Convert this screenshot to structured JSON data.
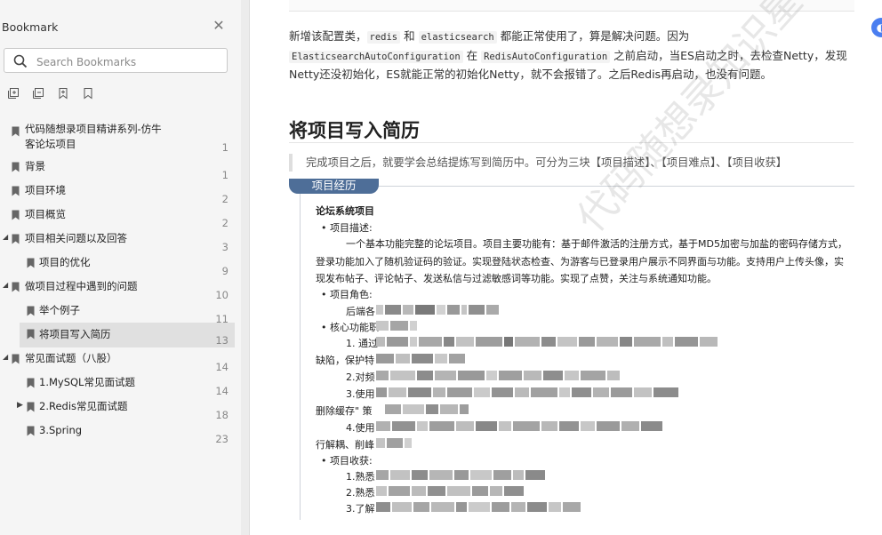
{
  "sidebar": {
    "title": "Bookmark",
    "search_placeholder": "Search Bookmarks",
    "bookmarks": [
      {
        "label": "代码随想录项目精讲系列-仿牛",
        "label2": "客论坛项目",
        "page": "1"
      },
      {
        "label": "背景",
        "page": "1"
      },
      {
        "label": "项目环境",
        "page": "2"
      },
      {
        "label": "项目概览",
        "page": "2"
      },
      {
        "label": "项目相关问题以及回答",
        "page": "3"
      },
      {
        "label": "项目的优化",
        "page": "9"
      },
      {
        "label": "做项目过程中遇到的问题",
        "page": "10"
      },
      {
        "label": "举个例子",
        "page": "11"
      },
      {
        "label": "将项目写入简历",
        "page": "13"
      },
      {
        "label": "常见面试题（八股）",
        "page": "14"
      },
      {
        "label": "1.MySQL常见面试题",
        "page": "14"
      },
      {
        "label": "2.Redis常见面试题",
        "page": "18"
      },
      {
        "label": "3.Spring",
        "page": "23"
      }
    ]
  },
  "content": {
    "para": {
      "t1": "新增该配置类，",
      "c1": "redis",
      "t2": " 和 ",
      "c2": "elasticsearch",
      "t3": " 都能正常使用了，算是解决问题。因为",
      "c3": "ElasticsearchAutoConfiguration",
      "t4": " 在 ",
      "c4": "RedisAutoConfiguration",
      "t5": " 之前启动，当ES启动之时，去检查Netty，发现Netty还没初始化，ES就能正常的初始化Netty，就不会报错了。之后Redis再启动，也没有问题。"
    },
    "heading": "将项目写入简历",
    "quote": "完成项目之后，就要学会总结提炼写到简历中。可分为三块【项目描述】、【项目难点】、【项目收获】",
    "resume": {
      "badge": "项目经历",
      "project_title": "论坛系统项目",
      "desc_label": "项目描述:",
      "desc_line1": "一个基本功能完整的论坛项目。项目主要功能有：基于邮件激活的注册方式，基于MD5加密与加盐的密码存储方式，",
      "desc_line2": "登录功能加入了随机验证码的验证。实现登陆状态检查、为游客与已登录用户展示不同界面与功能。支持用户上传头像，实",
      "desc_line3": "现发布帖子、评论帖子、发送私信与过滤敏感词等功能。实现了点赞，关注与系统通知功能。",
      "role_label": "项目角色:",
      "role_value": "后端各",
      "core_label": "核心功能职",
      "item1": "1. 通过",
      "cont1": "缺陷，保护特",
      "item2": "2.对频",
      "item3": "3.使用",
      "cont3": "删除缓存\" 策",
      "item4": "4.使用",
      "cont4": "行解耦、削峰",
      "gain_label": "项目收获:",
      "gain1": "1.熟悉",
      "gain2": "2.熟悉",
      "gain3": "3.了解"
    },
    "watermark": "代码随想录知识星球"
  }
}
